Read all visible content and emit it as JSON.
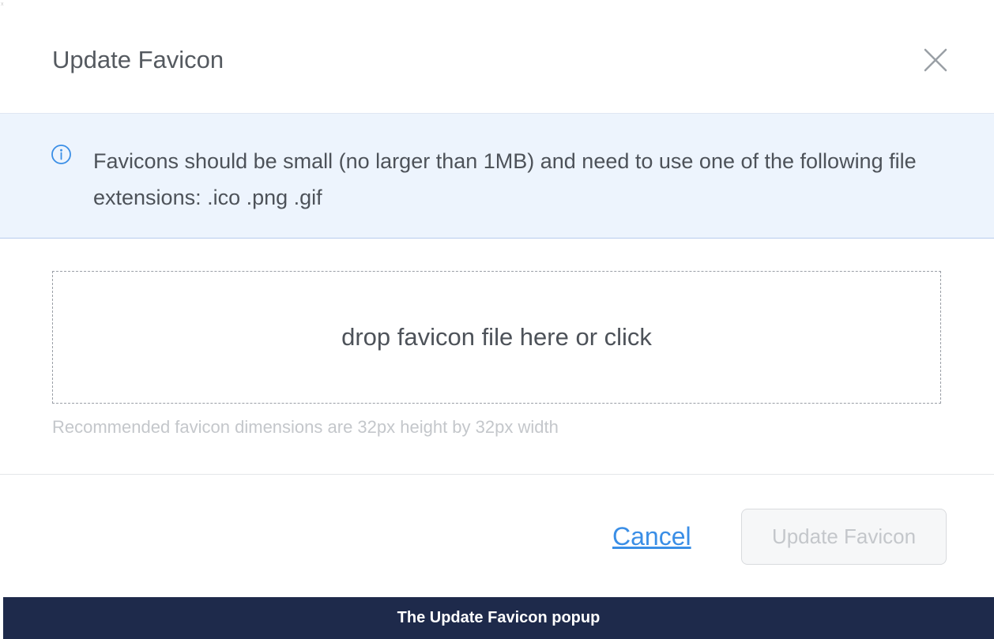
{
  "modal": {
    "title": "Update Favicon",
    "close_icon": "close-icon"
  },
  "info": {
    "icon": "info-icon",
    "text": "Favicons should be small (no larger than 1MB) and need to use one of the following file extensions: .ico .png .gif"
  },
  "dropzone": {
    "label": "drop favicon file here or click"
  },
  "hint": "Recommended favicon dimensions are 32px height by 32px width",
  "footer": {
    "cancel_label": "Cancel",
    "update_label": "Update Favicon",
    "update_disabled": true
  },
  "caption": "The Update Favicon popup",
  "colors": {
    "banner_bg": "#edf4fd",
    "link": "#3a8ee6",
    "caption_bg": "#1e2a4b"
  }
}
